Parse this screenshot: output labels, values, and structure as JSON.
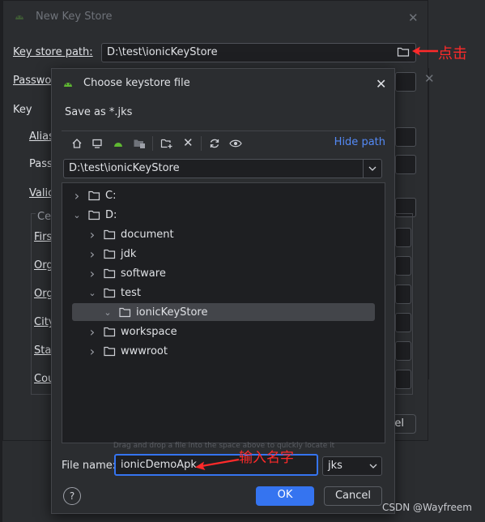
{
  "bg_window": {
    "title": "New Key Store",
    "key_store_path_label": "Key store path:",
    "key_store_path_value": "D:\\test\\ionicKeyStore",
    "password_label": "Passwo",
    "key_label": "Key",
    "alias_label": "Alias",
    "pass_label": "Pass",
    "validity_label": "Valio",
    "cert_label": "Cer",
    "first_label": "Firs",
    "org_unit_label": "Org",
    "org_label": "Org",
    "city_label": "City",
    "state_label": "Stat",
    "country_label": "Cou",
    "cancel_fragment": "el"
  },
  "dialog": {
    "title": "Choose keystore file",
    "subtitle": "Save as *.jks",
    "hide_path": "Hide path",
    "path_value": "D:\\test\\ionicKeyStore",
    "tree": [
      {
        "name": "C:",
        "expanded": false
      },
      {
        "name": "D:",
        "expanded": true
      },
      {
        "name": "document",
        "expanded": false
      },
      {
        "name": "jdk",
        "expanded": false
      },
      {
        "name": "software",
        "expanded": false
      },
      {
        "name": "test",
        "expanded": true
      },
      {
        "name": "ionicKeyStore",
        "expanded": true,
        "selected": true
      },
      {
        "name": "workspace",
        "expanded": false
      },
      {
        "name": "wwwroot",
        "expanded": false
      }
    ],
    "drag_hint": "Drag and drop a file into the space above to quickly locate it",
    "file_name_label": "File name:",
    "file_name_value": "ionicDemoApk",
    "extension": "jks",
    "ok": "OK",
    "cancel": "Cancel",
    "help": "?"
  },
  "annotations": {
    "click": "点击",
    "enter_name": "输入名字"
  },
  "watermark": "CSDN @Wayfreem",
  "colors": {
    "accent": "#3574f0",
    "link": "#548af7",
    "annotation": "#ff2a2a",
    "android": "#5fb832"
  }
}
